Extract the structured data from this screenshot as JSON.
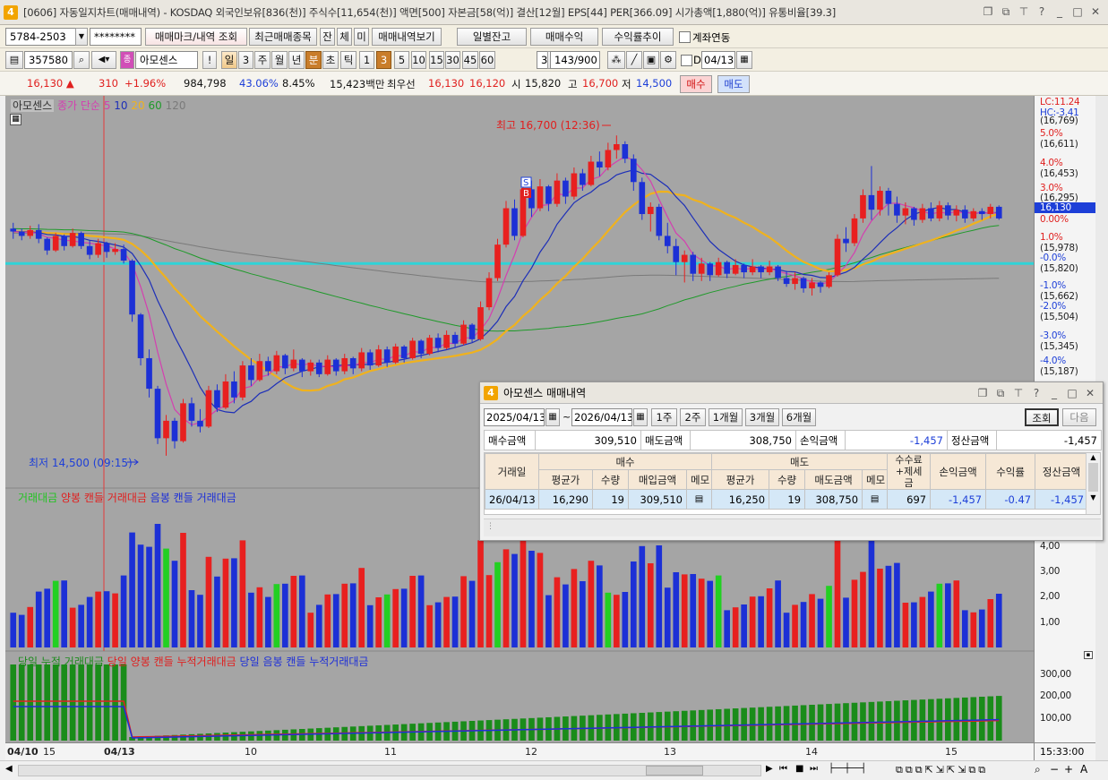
{
  "title": "[0606] 자동일지차트(매매내역) - KOSDAQ 외국인보유[836(천)] 주식수[11,654(천)] 액면[500] 자본금[58(억)] 결산[12월] EPS[44] PER[366.09] 시가총액[1,880(억)] 유통비율[39.3]",
  "app_badge": "4",
  "window_icons": [
    "restore-icon",
    "tile-icon",
    "pin-icon",
    "help-icon",
    "minimize-icon",
    "maximize-icon",
    "close-icon"
  ],
  "toolbar1": {
    "account": "5784-2503",
    "password": "********",
    "btn_trade_mark": "매매마크/내역 조회",
    "btn_recent": "최근매매종목",
    "btn_jan": "잔",
    "btn_che": "체",
    "btn_mi": "미",
    "btn_trade_view": "매매내역보기",
    "btn_daily_balance": "일별잔고",
    "btn_trade_profit": "매매수익",
    "btn_return_trend": "수익률추이",
    "chk_account_link": "계좌연동"
  },
  "toolbar2": {
    "code": "357580",
    "stock_name": "아모센스",
    "period_tabs": [
      "일",
      "3",
      "주",
      "월",
      "년",
      "분",
      "초",
      "틱",
      "1",
      "3",
      "5",
      "10",
      "15",
      "30",
      "45",
      "60"
    ],
    "selected_period": "분",
    "selected_minute": "3",
    "extra_value": "3",
    "count": "143",
    "count_max": "/900",
    "date_chk": "D",
    "date": "04/13"
  },
  "quote": {
    "price": "16,130",
    "change": "310",
    "change_pct": "+1.96%",
    "volume": "984,798",
    "vol_ratio": "43.06%",
    "turnover": "8.45%",
    "amount": "15,423백만",
    "ask_label": "최우선",
    "ask": "16,130",
    "bid": "16,120",
    "open_label": "시",
    "open": "15,820",
    "high_label": "고",
    "high": "16,700",
    "low_label": "저",
    "low": "14,500",
    "buy_btn": "매수",
    "sell_btn": "매도"
  },
  "chart": {
    "tab_name": "아모센스",
    "legend_ma_label": "종가 단순",
    "ma_periods": [
      "5",
      "10",
      "20",
      "60",
      "120"
    ],
    "lc": "LC:11.24",
    "hc": "HC:-3.41",
    "high_annot": "최고 16,700 (12:36)",
    "low_annot": "최저 14,500 (09:15)",
    "buy_mark": "B",
    "sell_mark": "S",
    "y_labels": [
      [
        "(16,769)",
        ""
      ],
      [
        "5.0%",
        "(16,611)"
      ],
      [
        "4.0%",
        "(16,453)"
      ],
      [
        "3.0%",
        "(16,295)"
      ],
      [
        "16,130",
        ""
      ],
      [
        "0.00%",
        ""
      ],
      [
        "1.0%",
        "(15,978)"
      ],
      [
        "-0.0%",
        "(15,820)"
      ],
      [
        "-1.0%",
        "(15,662)"
      ],
      [
        "-2.0%",
        "(15,504)"
      ],
      [
        "-3.0%",
        "(15,345)"
      ],
      [
        "-4.0%",
        "(15,187)"
      ]
    ],
    "vol_legend": [
      "거래대금",
      "양봉 캔들 거래대금",
      "음봉 캔들 거래대금"
    ],
    "vol_y_labels": [
      "4,00",
      "3,00",
      "2,00",
      "1,00"
    ],
    "cum_legend": [
      "당일 누적 거래대금",
      "당일 양봉 캔들 누적거래대금",
      "당일 음봉 캔들 누적거래대금"
    ],
    "cum_y_labels": [
      "300,00",
      "200,00",
      "100,00"
    ],
    "x_labels": [
      "04/10",
      "15",
      "04/13",
      "10",
      "11",
      "12",
      "13",
      "14",
      "15"
    ],
    "time": "15:33:00",
    "colors": {
      "up": "#e8201f",
      "down": "#1c30d6",
      "ma5": "#d43fb0",
      "ma10": "#1d2fb8",
      "ma20": "#f0b21d",
      "ma60": "#1f9a2a",
      "ma120": "#7a7a7a",
      "ref": "#2fd3d8",
      "bg": "#a5a5a5"
    }
  },
  "panel": {
    "badge": "4",
    "title": "아모센스 매매내역",
    "from": "2025/04/13",
    "to": "2026/04/13",
    "tilde": "~",
    "ranges": [
      "1주",
      "2주",
      "1개월",
      "3개월",
      "6개월"
    ],
    "btn_query": "조회",
    "btn_next": "다음",
    "summary": {
      "buy_amt_label": "매수금액",
      "buy_amt": "309,510",
      "sell_amt_label": "매도금액",
      "sell_amt": "308,750",
      "pl_label": "손익금액",
      "pl": "-1,457",
      "settle_label": "정산금액",
      "settle": "-1,457"
    },
    "headers": {
      "date": "거래일",
      "buy": "매수",
      "sell": "매도",
      "fee": "수수료\n+제세금",
      "pl": "손익금액",
      "ret": "수익률",
      "settle": "정산금액",
      "avg": "평균가",
      "qty": "수량",
      "buy_total": "매입금액",
      "memo": "메모",
      "sell_total": "매도금액"
    },
    "rows": [
      {
        "date": "26/04/13",
        "buy_avg": "16,290",
        "buy_qty": "19",
        "buy_amt": "309,510",
        "sell_avg": "16,250",
        "sell_qty": "19",
        "sell_amt": "308,750",
        "fee": "697",
        "pl": "-1,457",
        "ret": "-0.47",
        "settle": "-1,457"
      }
    ]
  },
  "candles": [
    [
      16060,
      16100,
      15990,
      16040
    ],
    [
      16040,
      16060,
      15980,
      16010
    ],
    [
      16010,
      16080,
      15990,
      16050
    ],
    [
      16050,
      16090,
      15960,
      15990
    ],
    [
      15990,
      16000,
      15880,
      15910
    ],
    [
      15910,
      16030,
      15900,
      16010
    ],
    [
      16010,
      16020,
      15910,
      15940
    ],
    [
      15940,
      16060,
      15930,
      16030
    ],
    [
      16030,
      16040,
      15920,
      15940
    ],
    [
      15940,
      15980,
      15850,
      15880
    ],
    [
      15880,
      15990,
      15860,
      15960
    ],
    [
      15960,
      15970,
      15860,
      15900
    ],
    [
      15900,
      15960,
      15880,
      15920
    ],
    [
      15920,
      15950,
      15820,
      15840
    ],
    [
      15840,
      15850,
      15420,
      15470
    ],
    [
      15470,
      15480,
      15120,
      15170
    ],
    [
      15170,
      15230,
      14900,
      14960
    ],
    [
      14960,
      14980,
      14580,
      14620
    ],
    [
      14620,
      14780,
      14500,
      14740
    ],
    [
      14740,
      14760,
      14550,
      14600
    ],
    [
      14600,
      14890,
      14590,
      14860
    ],
    [
      14860,
      14900,
      14700,
      14740
    ],
    [
      14740,
      14820,
      14660,
      14700
    ],
    [
      14700,
      14980,
      14690,
      14950
    ],
    [
      14950,
      14990,
      14800,
      14830
    ],
    [
      14830,
      15060,
      14820,
      15010
    ],
    [
      15010,
      15080,
      14860,
      14900
    ],
    [
      14900,
      15150,
      14880,
      15120
    ],
    [
      15120,
      15170,
      14980,
      15020
    ],
    [
      15020,
      15200,
      15010,
      15150
    ],
    [
      15150,
      15180,
      15050,
      15080
    ],
    [
      15080,
      15220,
      15060,
      15190
    ],
    [
      15190,
      15200,
      15060,
      15100
    ],
    [
      15100,
      15230,
      15080,
      15160
    ],
    [
      15160,
      15170,
      15040,
      15080
    ],
    [
      15080,
      15160,
      15050,
      15140
    ],
    [
      15140,
      15160,
      15040,
      15060
    ],
    [
      15060,
      15190,
      15050,
      15160
    ],
    [
      15160,
      15170,
      15050,
      15080
    ],
    [
      15080,
      15200,
      15060,
      15170
    ],
    [
      15170,
      15180,
      15060,
      15100
    ],
    [
      15100,
      15240,
      15080,
      15210
    ],
    [
      15210,
      15230,
      15090,
      15120
    ],
    [
      15120,
      15260,
      15110,
      15230
    ],
    [
      15230,
      15250,
      15110,
      15140
    ],
    [
      15140,
      15270,
      15130,
      15250
    ],
    [
      15250,
      15260,
      15140,
      15170
    ],
    [
      15170,
      15310,
      15160,
      15290
    ],
    [
      15290,
      15300,
      15170,
      15200
    ],
    [
      15200,
      15330,
      15190,
      15310
    ],
    [
      15310,
      15340,
      15210,
      15240
    ],
    [
      15240,
      15360,
      15230,
      15330
    ],
    [
      15330,
      15350,
      15240,
      15270
    ],
    [
      15270,
      15430,
      15260,
      15400
    ],
    [
      15400,
      15410,
      15280,
      15300
    ],
    [
      15300,
      15560,
      15290,
      15520
    ],
    [
      15520,
      15760,
      15500,
      15720
    ],
    [
      15720,
      15990,
      15700,
      15950
    ],
    [
      15950,
      16250,
      15930,
      16200
    ],
    [
      16200,
      16260,
      15980,
      16010
    ],
    [
      16010,
      16380,
      16000,
      16330
    ],
    [
      16330,
      16390,
      16140,
      16200
    ],
    [
      16200,
      16400,
      16180,
      16350
    ],
    [
      16350,
      16360,
      16180,
      16230
    ],
    [
      16230,
      16440,
      16210,
      16390
    ],
    [
      16390,
      16410,
      16230,
      16280
    ],
    [
      16280,
      16480,
      16260,
      16440
    ],
    [
      16440,
      16470,
      16320,
      16360
    ],
    [
      16360,
      16560,
      16350,
      16520
    ],
    [
      16520,
      16590,
      16420,
      16480
    ],
    [
      16480,
      16650,
      16460,
      16600
    ],
    [
      16600,
      16700,
      16540,
      16640
    ],
    [
      16640,
      16660,
      16510,
      16540
    ],
    [
      16540,
      16570,
      16320,
      16380
    ],
    [
      16380,
      16410,
      16120,
      16160
    ],
    [
      16160,
      16240,
      16040,
      16210
    ],
    [
      16210,
      16230,
      15980,
      16010
    ],
    [
      16010,
      16100,
      15890,
      15940
    ],
    [
      15940,
      15990,
      15740,
      15830
    ],
    [
      15830,
      15910,
      15690,
      15880
    ],
    [
      15880,
      15900,
      15700,
      15750
    ],
    [
      15750,
      15860,
      15700,
      15820
    ],
    [
      15820,
      15830,
      15700,
      15740
    ],
    [
      15740,
      15860,
      15730,
      15830
    ],
    [
      15830,
      15840,
      15720,
      15750
    ],
    [
      15750,
      15850,
      15740,
      15810
    ],
    [
      15810,
      15820,
      15720,
      15760
    ],
    [
      15760,
      15850,
      15740,
      15800
    ],
    [
      15800,
      15810,
      15720,
      15760
    ],
    [
      15760,
      15840,
      15740,
      15800
    ],
    [
      15800,
      15810,
      15700,
      15720
    ],
    [
      15720,
      15770,
      15660,
      15680
    ],
    [
      15680,
      15760,
      15640,
      15720
    ],
    [
      15720,
      15730,
      15620,
      15650
    ],
    [
      15650,
      15720,
      15600,
      15690
    ],
    [
      15690,
      15700,
      15620,
      15660
    ],
    [
      15660,
      15760,
      15650,
      15740
    ],
    [
      15740,
      16020,
      15730,
      15990
    ],
    [
      15990,
      16070,
      15900,
      15960
    ],
    [
      15960,
      16160,
      15940,
      16130
    ],
    [
      16130,
      16330,
      16100,
      16290
    ],
    [
      16290,
      16490,
      16120,
      16190
    ],
    [
      16190,
      16350,
      16150,
      16320
    ],
    [
      16320,
      16340,
      16150,
      16230
    ],
    [
      16230,
      16280,
      16100,
      16150
    ],
    [
      16150,
      16240,
      16090,
      16200
    ],
    [
      16200,
      16210,
      16080,
      16120
    ],
    [
      16120,
      16230,
      16100,
      16200
    ],
    [
      16200,
      16240,
      16110,
      16130
    ],
    [
      16130,
      16250,
      16110,
      16220
    ],
    [
      16220,
      16240,
      16120,
      16150
    ],
    [
      16150,
      16220,
      16110,
      16190
    ],
    [
      16190,
      16220,
      16100,
      16130
    ],
    [
      16130,
      16200,
      16110,
      16180
    ],
    [
      16180,
      16200,
      16120,
      16160
    ],
    [
      16160,
      16230,
      16130,
      16210
    ],
    [
      16210,
      16220,
      16120,
      16130
    ]
  ]
}
